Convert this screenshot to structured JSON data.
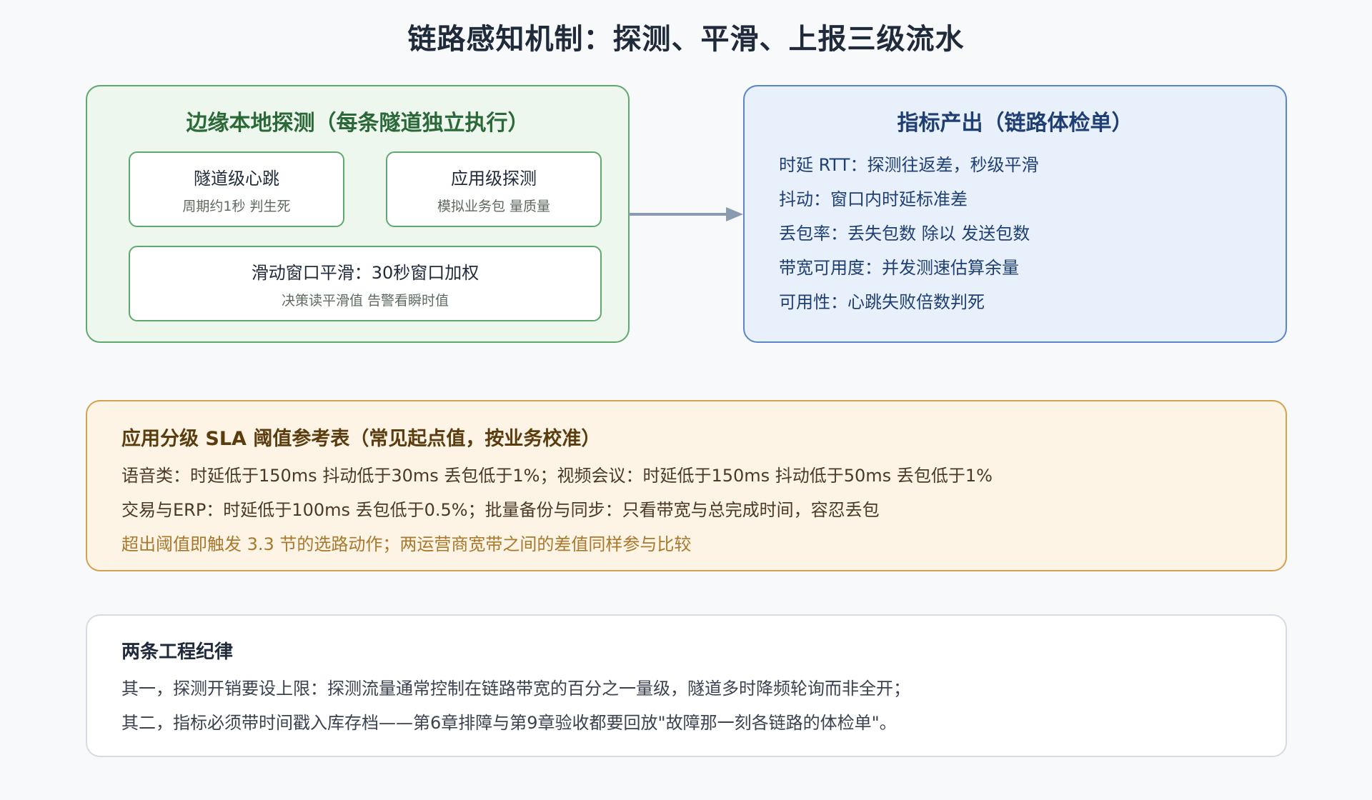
{
  "title": "链路感知机制：探测、平滑、上报三级流水",
  "local_probe": {
    "title": "边缘本地探测（每条隧道独立执行）",
    "heartbeat": {
      "title": "隧道级心跳",
      "subtitle": "周期约1秒 判生死"
    },
    "app_probe": {
      "title": "应用级探测",
      "subtitle": "模拟业务包 量质量"
    },
    "smoothing": {
      "title": "滑动窗口平滑：30秒窗口加权",
      "subtitle": "决策读平滑值 告警看瞬时值"
    }
  },
  "metrics": {
    "title": "指标产出（链路体检单）",
    "items": [
      "时延 RTT：探测往返差，秒级平滑",
      "抖动：窗口内时延标准差",
      "丢包率：丢失包数 除以 发送包数",
      "带宽可用度：并发测速估算余量",
      "可用性：心跳失败倍数判死"
    ]
  },
  "sla": {
    "title": "应用分级 SLA 阈值参考表（常见起点值，按业务校准）",
    "lines": [
      "语音类：时延低于150ms 抖动低于30ms 丢包低于1%；视频会议：时延低于150ms 抖动低于50ms 丢包低于1%",
      "交易与ERP：时延低于100ms 丢包低于0.5%；批量备份与同步：只看带宽与总完成时间，容忍丢包"
    ],
    "note": "超出阈值即触发 3.3 节的选路动作；两运营商宽带之间的差值同样参与比较"
  },
  "rules": {
    "title": "两条工程纪律",
    "lines": [
      "其一，探测开销要设上限：探测流量通常控制在链路带宽的百分之一量级，隧道多时降频轮询而非全开；",
      "其二，指标必须带时间戳入库存档——第6章排障与第9章验收都要回放\"故障那一刻各链路的体检单\"。"
    ]
  },
  "colors": {
    "local_border": "#5fa870",
    "metrics_border": "#5b86c6",
    "sla_border": "#d4a24c",
    "arrow": "#8a9bb0"
  }
}
